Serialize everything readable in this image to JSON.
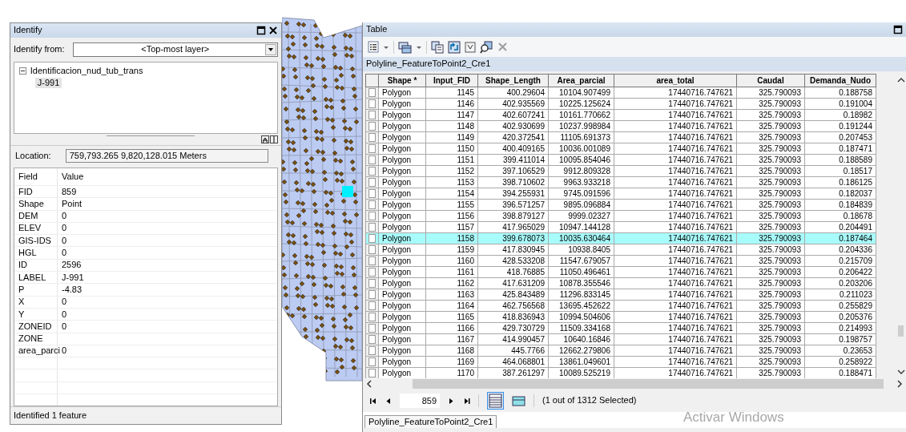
{
  "identify": {
    "title": "Identify",
    "from_label": "Identify from:",
    "from_value": "<Top-most layer>",
    "tree": [
      {
        "label": "Identificacion_nud_tub_trans",
        "expanded": true,
        "children": [
          {
            "label": "J-991",
            "selected": true
          }
        ]
      }
    ],
    "location_label": "Location:",
    "location_value": "759,793.265  9,820,128.015 Meters",
    "columns": [
      "Field",
      "Value"
    ],
    "fields": [
      {
        "field": "FID",
        "value": "859"
      },
      {
        "field": "Shape",
        "value": "Point"
      },
      {
        "field": "DEM",
        "value": "0"
      },
      {
        "field": "ELEV",
        "value": "0"
      },
      {
        "field": "GIS-IDS",
        "value": "0"
      },
      {
        "field": "HGL",
        "value": "0"
      },
      {
        "field": "ID",
        "value": "2596"
      },
      {
        "field": "LABEL",
        "value": "J-991"
      },
      {
        "field": "P",
        "value": "-4.83"
      },
      {
        "field": "X",
        "value": "0"
      },
      {
        "field": "Y",
        "value": "0"
      },
      {
        "field": "ZONEID",
        "value": "0"
      },
      {
        "field": "ZONE"
      },
      {
        "field": "area_parci",
        "value": "0"
      }
    ],
    "status": "Identified 1 feature"
  },
  "table_window": {
    "title": "Table",
    "layer_title": "Polyline_FeatureToPoint2_Cre1",
    "columns": [
      "Shape *",
      "Input_FID",
      "Shape_Length",
      "Area_parcial",
      "area_total",
      "Caudal",
      "Demanda_Nudo"
    ],
    "rows": [
      {
        "cells": [
          "Polygon",
          "1145",
          "400.29604",
          "10104.907499",
          "17440716.747621",
          "325.790093",
          "0.188758"
        ],
        "selected": false
      },
      {
        "cells": [
          "Polygon",
          "1146",
          "402.935569",
          "10225.125624",
          "17440716.747621",
          "325.790093",
          "0.191004"
        ],
        "selected": false
      },
      {
        "cells": [
          "Polygon",
          "1147",
          "402.607241",
          "10161.770662",
          "17440716.747621",
          "325.790093",
          "0.18982"
        ],
        "selected": false
      },
      {
        "cells": [
          "Polygon",
          "1148",
          "402.930699",
          "10237.998984",
          "17440716.747621",
          "325.790093",
          "0.191244"
        ],
        "selected": false
      },
      {
        "cells": [
          "Polygon",
          "1149",
          "420.372541",
          "11105.691373",
          "17440716.747621",
          "325.790093",
          "0.207453"
        ],
        "selected": false
      },
      {
        "cells": [
          "Polygon",
          "1150",
          "400.409165",
          "10036.001089",
          "17440716.747621",
          "325.790093",
          "0.187471"
        ],
        "selected": false
      },
      {
        "cells": [
          "Polygon",
          "1151",
          "399.411014",
          "10095.854046",
          "17440716.747621",
          "325.790093",
          "0.188589"
        ],
        "selected": false
      },
      {
        "cells": [
          "Polygon",
          "1152",
          "397.106529",
          "9912.809328",
          "17440716.747621",
          "325.790093",
          "0.18517"
        ],
        "selected": false
      },
      {
        "cells": [
          "Polygon",
          "1153",
          "398.710602",
          "9963.933218",
          "17440716.747621",
          "325.790093",
          "0.186125"
        ],
        "selected": false
      },
      {
        "cells": [
          "Polygon",
          "1154",
          "394.255931",
          "9745.091596",
          "17440716.747621",
          "325.790093",
          "0.182037"
        ],
        "selected": false
      },
      {
        "cells": [
          "Polygon",
          "1155",
          "396.571257",
          "9895.096884",
          "17440716.747621",
          "325.790093",
          "0.184839"
        ],
        "selected": false
      },
      {
        "cells": [
          "Polygon",
          "1156",
          "398.879127",
          "9999.02327",
          "17440716.747621",
          "325.790093",
          "0.18678"
        ],
        "selected": false
      },
      {
        "cells": [
          "Polygon",
          "1157",
          "417.965029",
          "10947.144128",
          "17440716.747621",
          "325.790093",
          "0.204491"
        ],
        "selected": false
      },
      {
        "cells": [
          "Polygon",
          "1158",
          "399.678073",
          "10035.630464",
          "17440716.747621",
          "325.790093",
          "0.187464"
        ],
        "selected": true
      },
      {
        "cells": [
          "Polygon",
          "1159",
          "417.830945",
          "10938.8405",
          "17440716.747621",
          "325.790093",
          "0.204336"
        ],
        "selected": false
      },
      {
        "cells": [
          "Polygon",
          "1160",
          "428.533208",
          "11547.679057",
          "17440716.747621",
          "325.790093",
          "0.215709"
        ],
        "selected": false
      },
      {
        "cells": [
          "Polygon",
          "1161",
          "418.76885",
          "11050.496461",
          "17440716.747621",
          "325.790093",
          "0.206422"
        ],
        "selected": false
      },
      {
        "cells": [
          "Polygon",
          "1162",
          "417.631209",
          "10878.355546",
          "17440716.747621",
          "325.790093",
          "0.203206"
        ],
        "selected": false
      },
      {
        "cells": [
          "Polygon",
          "1163",
          "425.843489",
          "11296.833145",
          "17440716.747621",
          "325.790093",
          "0.211023"
        ],
        "selected": false
      },
      {
        "cells": [
          "Polygon",
          "1164",
          "462.756568",
          "13695.452622",
          "17440716.747621",
          "325.790093",
          "0.255829"
        ],
        "selected": false
      },
      {
        "cells": [
          "Polygon",
          "1165",
          "418.836943",
          "10994.504606",
          "17440716.747621",
          "325.790093",
          "0.205376"
        ],
        "selected": false
      },
      {
        "cells": [
          "Polygon",
          "1166",
          "429.730729",
          "11509.334168",
          "17440716.747621",
          "325.790093",
          "0.214993"
        ],
        "selected": false
      },
      {
        "cells": [
          "Polygon",
          "1167",
          "414.990457",
          "10640.16846",
          "17440716.747621",
          "325.790093",
          "0.198757"
        ],
        "selected": false
      },
      {
        "cells": [
          "Polygon",
          "1168",
          "445.7766",
          "12662.279806",
          "17440716.747621",
          "325.790093",
          "0.23653"
        ],
        "selected": false
      },
      {
        "cells": [
          "Polygon",
          "1169",
          "464.068801",
          "13861.049601",
          "17440716.747621",
          "325.790093",
          "0.258922"
        ],
        "selected": false
      },
      {
        "cells": [
          "Polygon",
          "1170",
          "387.261297",
          "10089.525219",
          "17440716.747621",
          "325.790093",
          "0.188471"
        ],
        "selected": false
      }
    ],
    "record": "859",
    "selection_text": "(1 out of 1312 Selected)",
    "bottom_tab": "Polyline_FeatureToPoint2_Cre1"
  },
  "os_notice": "Activar Windows"
}
